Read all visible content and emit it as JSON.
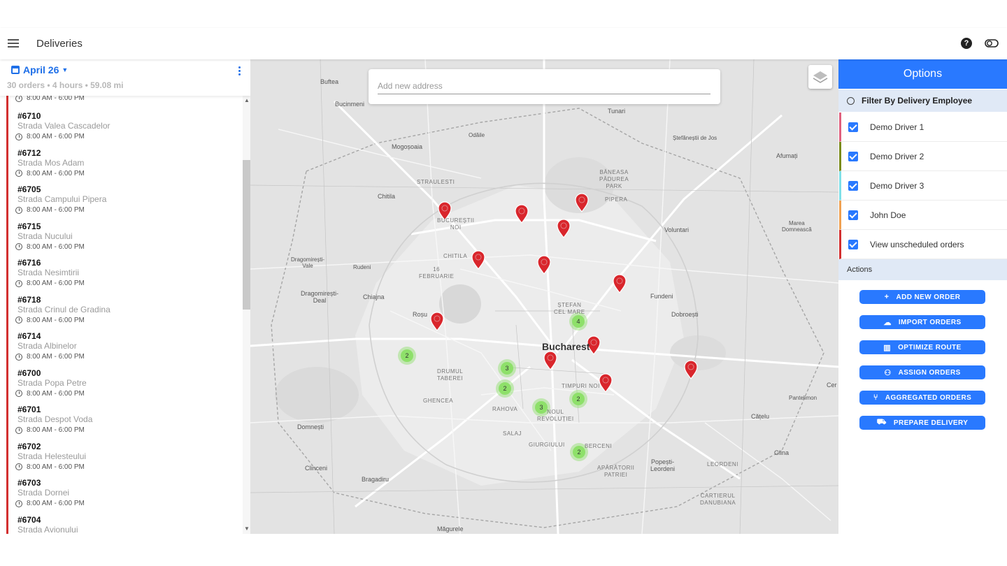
{
  "header": {
    "title": "Deliveries"
  },
  "date_panel": {
    "date": "April 26",
    "summary": "30 orders • 4 hours • 59.08 mi"
  },
  "orders": [
    {
      "time": "8:00 AM - 6:00 PM"
    },
    {
      "id": "#6710",
      "street": "Strada Valea Cascadelor",
      "time": "8:00 AM - 6:00 PM"
    },
    {
      "id": "#6712",
      "street": "Strada Mos Adam",
      "time": "8:00 AM - 6:00 PM"
    },
    {
      "id": "#6705",
      "street": "Strada Campului Pipera",
      "time": "8:00 AM - 6:00 PM"
    },
    {
      "id": "#6715",
      "street": "Strada Nucului",
      "time": "8:00 AM - 6:00 PM"
    },
    {
      "id": "#6716",
      "street": "Strada Nesimtirii",
      "time": "8:00 AM - 6:00 PM"
    },
    {
      "id": "#6718",
      "street": "Strada Crinul de Gradina",
      "time": "8:00 AM - 6:00 PM"
    },
    {
      "id": "#6714",
      "street": "Strada Albinelor",
      "time": "8:00 AM - 6:00 PM"
    },
    {
      "id": "#6700",
      "street": "Strada Popa Petre",
      "time": "8:00 AM - 6:00 PM"
    },
    {
      "id": "#6701",
      "street": "Strada Despot Voda",
      "time": "8:00 AM - 6:00 PM"
    },
    {
      "id": "#6702",
      "street": "Strada Helesteului",
      "time": "8:00 AM - 6:00 PM"
    },
    {
      "id": "#6703",
      "street": "Strada Dornei",
      "time": "8:00 AM - 6:00 PM"
    },
    {
      "id": "#6704",
      "street": "Strada Avionului"
    }
  ],
  "map": {
    "search_placeholder": "Add new address",
    "labels": {
      "buftea": "Buftea",
      "bucinmeni": "Bucinmeni",
      "tunari": "Tunari",
      "odaile": "Odăile",
      "mogosoaia": "Mogoșoaia",
      "stefanestii": "Ștefăneștii de Jos",
      "afumati": "Afumați",
      "baneasa": "BĂNEASA\nPĂDUREA\nPARK",
      "straulesti": "STRAULESTI",
      "chitila": "Chitila",
      "pipera": "PIPERA",
      "bucurestii_noi": "BUCUREȘTII\nNOI",
      "voluntari": "Voluntari",
      "marea_domneasca": "Marea\nDomnească",
      "chitila2": "CHITILA",
      "dragomiresti_vale": "Dragomirești-\nVale",
      "rudeni": "Rudeni",
      "sector16": "16\nFEBRUARIE",
      "fundeni": "Fundeni",
      "dragomiresti_deal": "Dragomirești-\nDeal",
      "chiajna": "Chiajna",
      "stefan_cel_mare": "ȘTEFAN\nCEL MARE",
      "dobroesti": "Dobroești",
      "rosu": "Roșu",
      "bucharest": "Bucharest",
      "drumul_taberei": "DRUMUL\nTABEREI",
      "timpuri_noi": "TIMPURI NOI",
      "ghencea": "GHENCEA",
      "rahova": "RAHOVA",
      "noua_brancoveanu": "NOUL\nREVOLUȚIEI",
      "pantelimon": "Pantelimon",
      "domnesti": "Domnești",
      "salaj": "SALAJ",
      "catelu": "Cățelu",
      "giurgiului": "GIURGIULUI",
      "berceni": "BERCENI",
      "glina": "Glina",
      "clinceni": "Clinceni",
      "popesti": "Popești-\nLeordeni",
      "leordeni": "LEORDENI",
      "bragadiru": "Bragadiru",
      "aparatorii": "APĂRĂTORII\nPATRIEI",
      "cartierul": "CARTIERUL\nDANUBIANA",
      "magurele": "Măgurele",
      "cer": "Cer"
    },
    "clusters": [
      "4",
      "2",
      "3",
      "2",
      "3",
      "2",
      "2"
    ]
  },
  "options_panel": {
    "title": "Options",
    "filter_title": "Filter By Delivery Employee",
    "drivers": [
      {
        "name": "Demo Driver 1",
        "color": "#e0607e"
      },
      {
        "name": "Demo Driver 2",
        "color": "#7a8b1a"
      },
      {
        "name": "Demo Driver 3",
        "color": "#7fe0e8"
      },
      {
        "name": "John Doe",
        "color": "#f0a050"
      },
      {
        "name": "View unscheduled orders",
        "color": "#d32f2f"
      }
    ],
    "actions_title": "Actions",
    "actions": [
      {
        "label": "ADD NEW ORDER",
        "icon": "plus-icon"
      },
      {
        "label": "IMPORT ORDERS",
        "icon": "cloud-upload-icon"
      },
      {
        "label": "OPTIMIZE ROUTE",
        "icon": "map-icon"
      },
      {
        "label": "ASSIGN ORDERS",
        "icon": "people-icon"
      },
      {
        "label": "AGGREGATED ORDERS",
        "icon": "merge-icon"
      },
      {
        "label": "PREPARE DELIVERY",
        "icon": "truck-icon"
      }
    ]
  },
  "colors": {
    "accent": "#2979ff",
    "marker": "#d9262c",
    "cluster": "#8ee06a",
    "unscheduled": "#d32f2f"
  }
}
